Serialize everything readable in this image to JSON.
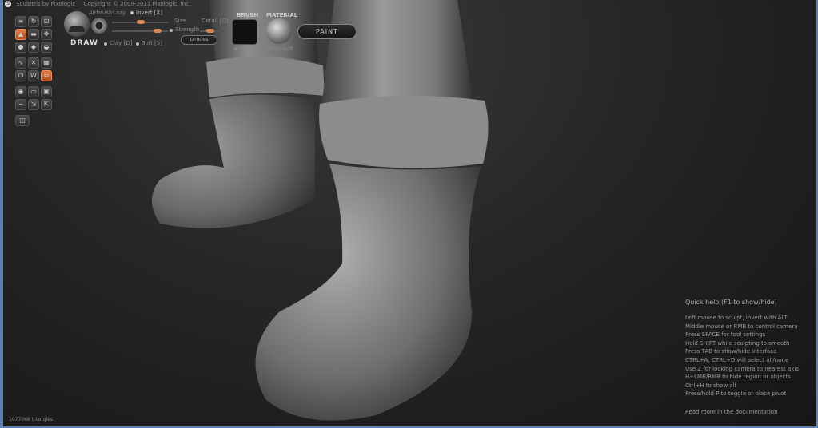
{
  "window": {
    "title": "Sculptris by Pixologic",
    "copyright": "Copyright © 2009-2011 Pixologic, Inc."
  },
  "toolbar": {
    "tools": [
      [
        "",
        "",
        ""
      ],
      [
        "",
        "",
        ""
      ],
      [
        "",
        "",
        ""
      ],
      [
        "",
        "",
        ""
      ],
      [
        "",
        "",
        ""
      ],
      [
        "",
        "",
        ""
      ],
      [
        "",
        "",
        ""
      ],
      [
        "",
        "",
        ""
      ]
    ],
    "active_tool_index": 3
  },
  "brush": {
    "mode_label": "DRAW",
    "airbrush_label": "Airbrush",
    "lazy_label": "Lazy",
    "invert_label": "Invert [X]",
    "size_label": "Size",
    "detail_label": "Detail [Q]",
    "strength_label": "Strength",
    "clay_label": "Clay [D]",
    "soft_label": "Soft [S]",
    "options_label": "OPTIONS",
    "brush_header": "BRUSH",
    "enable_label": "Enable",
    "material_header": "MATERIAL",
    "material_name": "00default"
  },
  "paint_button": "PAINT",
  "help": {
    "title": "Quick help (F1 to show/hide)",
    "lines": [
      "Left mouse to sculpt, invert with ALT",
      "Middle mouse or RMB to control camera",
      "Press SPACE for tool settings",
      "Hold SHIFT while sculpting to smooth",
      "Press TAB to show/hide interface",
      "CTRL+A, CTRL+D will select all/none",
      "Use Z for locking camera to nearest axis",
      "H+LMB/RMB to hide region or objects",
      "Ctrl+H to show all",
      "Press/hold P to toggle or place pivot"
    ],
    "more": "Read more in the documentation"
  },
  "status": {
    "triangles": "1077068 triangles"
  },
  "colors": {
    "accent": "#d7864e",
    "frame": "#5b7fb0",
    "background": "#1e1e1e"
  }
}
